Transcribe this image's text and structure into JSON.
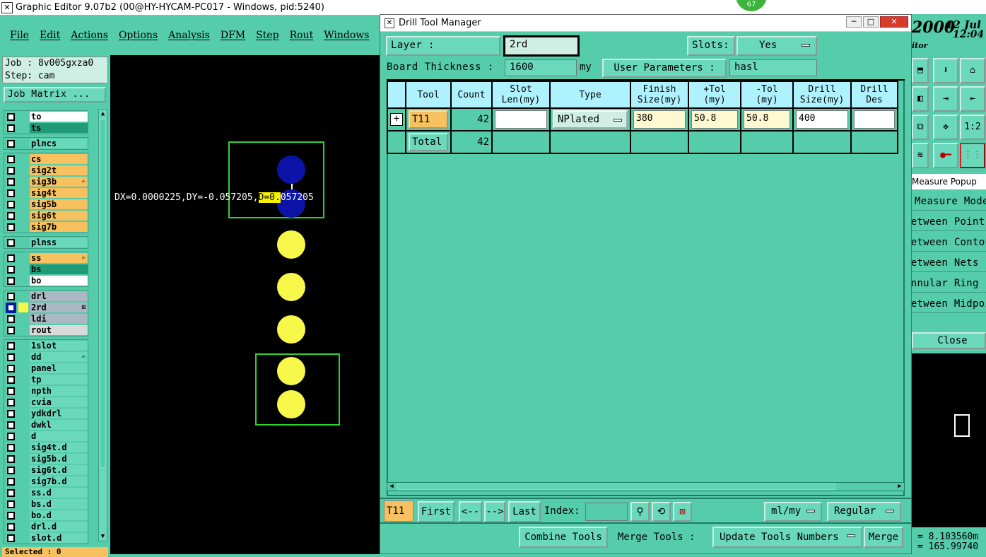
{
  "main_window": {
    "title": "Graphic Editor 9.07b2 (00@HY-HYCAM-PC017 - Windows, pid:5240)",
    "badge": "67",
    "menu": [
      "File",
      "Edit",
      "Actions",
      "Options",
      "Analysis",
      "DFM",
      "Step",
      "Rout",
      "Windows"
    ]
  },
  "left_panel": {
    "job": "Job : 8v005gxza0",
    "step": "Step: cam",
    "job_matrix": "Job Matrix ...",
    "selected": "Selected : 0",
    "layer_groups": [
      [
        {
          "name": "to",
          "color": "#ffffff"
        },
        {
          "name": "ts",
          "color": "#1f9b78"
        }
      ],
      [
        {
          "name": "plncs",
          "color": "#6ad8bb"
        }
      ],
      [
        {
          "name": "cs",
          "color": "#f6c15e"
        },
        {
          "name": "sig2t",
          "color": "#f6c15e"
        },
        {
          "name": "sig3b",
          "color": "#f6c15e",
          "mark": "✍"
        },
        {
          "name": "sig4t",
          "color": "#f6c15e"
        },
        {
          "name": "sig5b",
          "color": "#f6c15e"
        },
        {
          "name": "sig6t",
          "color": "#f6c15e"
        },
        {
          "name": "sig7b",
          "color": "#f6c15e"
        }
      ],
      [
        {
          "name": "plnss",
          "color": "#6ad8bb"
        }
      ],
      [
        {
          "name": "ss",
          "color": "#f6c15e",
          "mark": "✍"
        },
        {
          "name": "bs",
          "color": "#1f9b78"
        },
        {
          "name": "bo",
          "color": "#ffffff"
        }
      ],
      [
        {
          "name": "drl",
          "color": "#a9b8c2"
        },
        {
          "name": "2rd",
          "color": "#a9b8c2",
          "active": true,
          "mark": "⊞"
        },
        {
          "name": "ldi",
          "color": "#a9b8c2"
        },
        {
          "name": "rout",
          "color": "#d9d9d9"
        }
      ],
      [
        {
          "name": "1slot",
          "color": "#6ad8bb"
        },
        {
          "name": "dd",
          "color": "#6ad8bb",
          "mark": "✍"
        },
        {
          "name": "panel",
          "color": "#6ad8bb"
        },
        {
          "name": "tp",
          "color": "#6ad8bb"
        },
        {
          "name": "npth",
          "color": "#6ad8bb"
        },
        {
          "name": "cvia",
          "color": "#6ad8bb"
        },
        {
          "name": "ydkdrl",
          "color": "#6ad8bb"
        },
        {
          "name": "dwkl",
          "color": "#6ad8bb"
        },
        {
          "name": "d",
          "color": "#6ad8bb"
        },
        {
          "name": "sig4t.d",
          "color": "#6ad8bb"
        },
        {
          "name": "sig5b.d",
          "color": "#6ad8bb"
        },
        {
          "name": "sig6t.d",
          "color": "#6ad8bb"
        },
        {
          "name": "sig7b.d",
          "color": "#6ad8bb"
        },
        {
          "name": "ss.d",
          "color": "#6ad8bb"
        },
        {
          "name": "bs.d",
          "color": "#6ad8bb"
        },
        {
          "name": "bo.d",
          "color": "#6ad8bb"
        },
        {
          "name": "drl.d",
          "color": "#6ad8bb"
        },
        {
          "name": "slot.d",
          "color": "#6ad8bb"
        }
      ]
    ]
  },
  "canvas": {
    "readout_pre": "DX=0.0000225,DY=-0.057205,",
    "readout_hl": "D=0.",
    "readout_post": "057205"
  },
  "drill_tool_manager": {
    "title": "Drill Tool Manager",
    "layer_label": "Layer          :",
    "layer_value": "2rd",
    "slots_label": "Slots:",
    "slots_value": "Yes",
    "board_thickness_label": "Board Thickness :",
    "board_thickness_value": "1600",
    "board_thickness_unit": "my",
    "user_params_label": "User Parameters :",
    "user_params_value": "hasl",
    "columns": [
      "Tool",
      "Count",
      "Slot\nLen(my)",
      "Type",
      "Finish\nSize(my)",
      "+Tol\n(my)",
      "-Tol\n(my)",
      "Drill\nSize(my)",
      "Drill\nDes"
    ],
    "rows": [
      {
        "tool": "T11",
        "count": "42",
        "slot_len": "",
        "type": "NPlated",
        "finish": "380",
        "ptol": "50.8",
        "mtol": "50.8",
        "drill": "400",
        "des": ""
      }
    ],
    "total": {
      "label": "Total",
      "count": "42"
    },
    "nav": {
      "current": "T11",
      "first": "First",
      "prev": "<--",
      "next": "-->",
      "last": "Last",
      "index_label": "Index:",
      "index_value": "",
      "units": "ml/my",
      "mode": "Regular"
    },
    "bottom": {
      "combine": "Combine Tools",
      "merge_label": "Merge Tools :",
      "update": "Update Tools Numbers",
      "merge": "Merge"
    }
  },
  "right_panel": {
    "year": "2000",
    "date": "12 Jul",
    "time": "12:04",
    "sub": "itor",
    "measure_title": "Measure Popup",
    "measure_items": [
      "Measure Mode",
      "Between Points",
      "Between Contours",
      "Between Nets",
      "Annular Ring",
      "Between Midpoints"
    ],
    "close": "Close",
    "coord1": "= 8.103560m",
    "coord2": "= 165.99740"
  }
}
